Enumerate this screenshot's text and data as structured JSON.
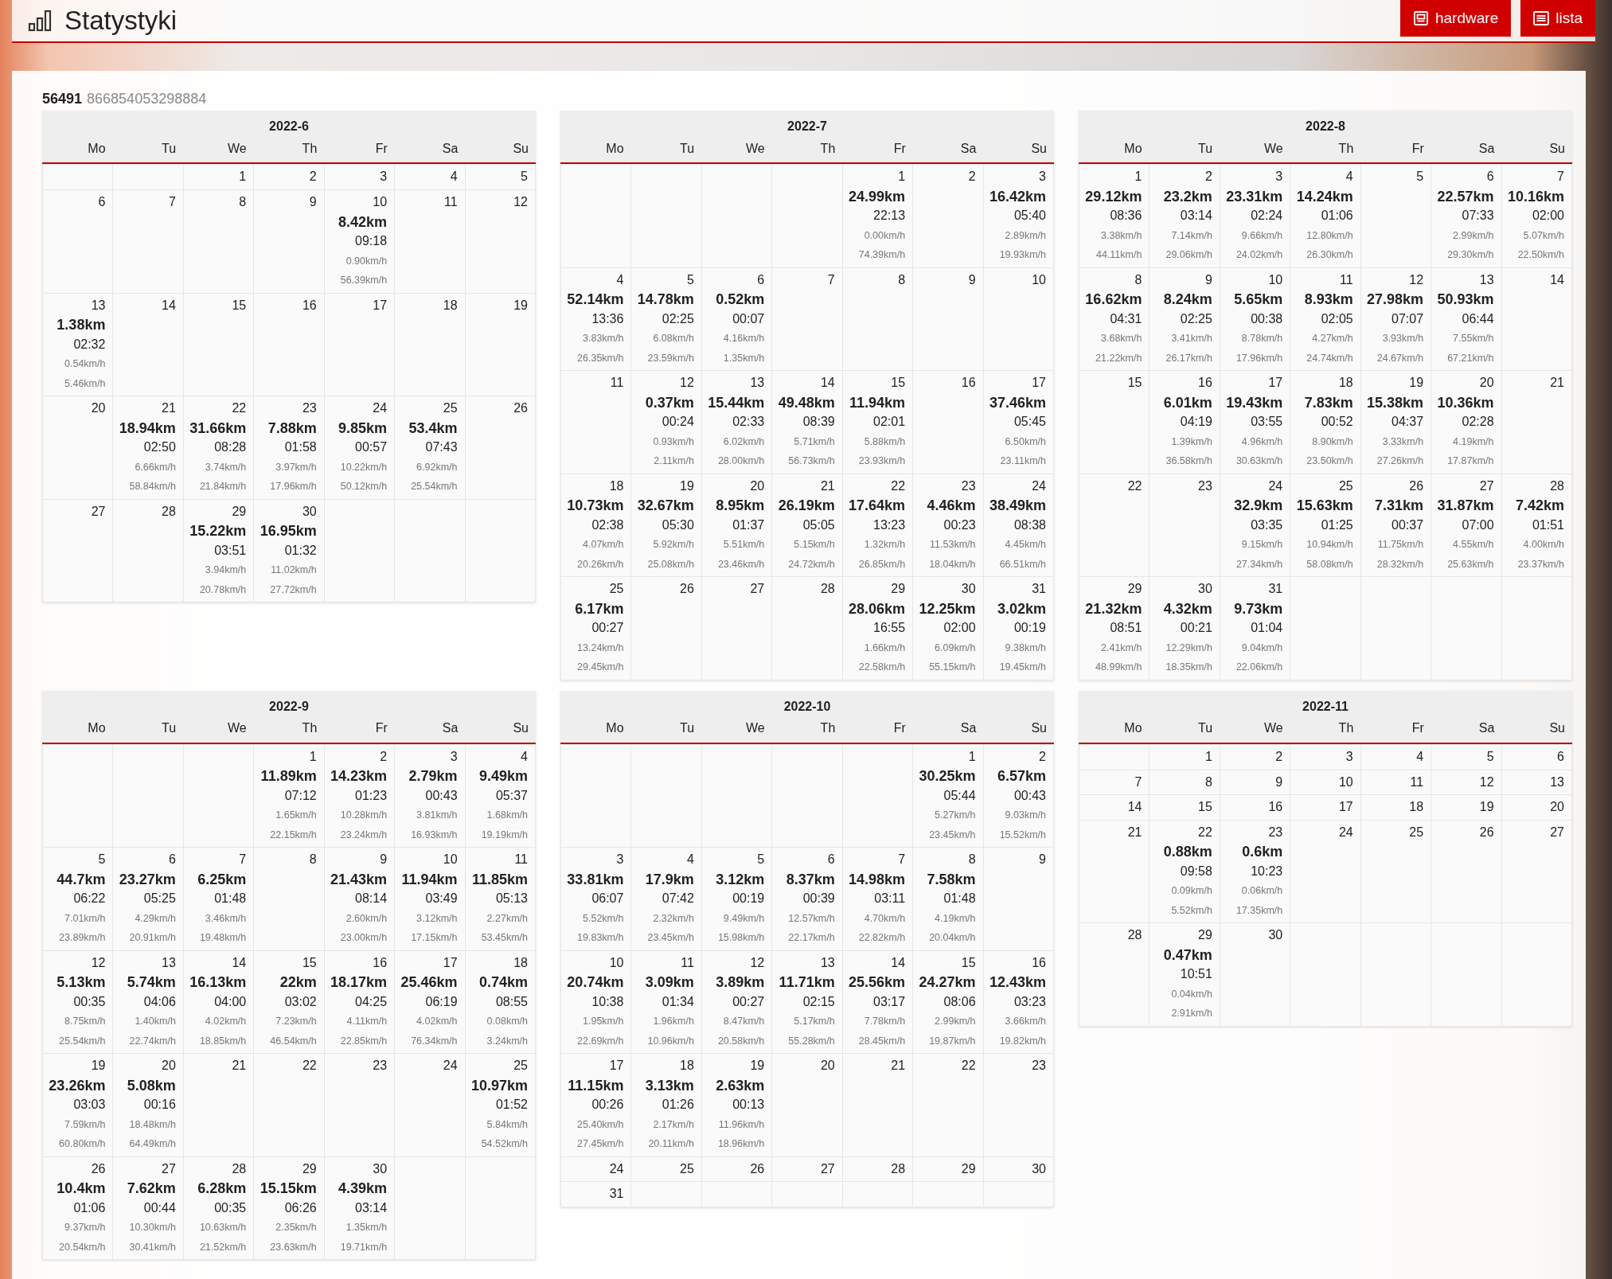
{
  "header": {
    "title": "Statystyki",
    "buttons": [
      {
        "label": "hardware",
        "kind": "hardware"
      },
      {
        "label": "lista",
        "kind": "list"
      }
    ]
  },
  "device": {
    "id": "56491",
    "serial": "866854053298884"
  },
  "months": [
    {
      "title": "2022-6",
      "weekdays": [
        "Mo",
        "Tu",
        "We",
        "Th",
        "Fr",
        "Sa",
        "Su"
      ],
      "weeks": [
        [
          {
            "kind": "blank"
          },
          {
            "kind": "blank"
          },
          {
            "day": "1"
          },
          {
            "day": "2"
          },
          {
            "day": "3"
          },
          {
            "day": "4"
          },
          {
            "day": "5"
          }
        ],
        [
          {
            "day": "6"
          },
          {
            "day": "7"
          },
          {
            "day": "8"
          },
          {
            "day": "9"
          },
          {
            "day": "10",
            "distance": "8.42km",
            "duration": "09:18",
            "speed_1": "0.90km/h",
            "speed_2": "56.39km/h"
          },
          {
            "day": "11"
          },
          {
            "day": "12"
          }
        ],
        [
          {
            "day": "13",
            "distance": "1.38km",
            "duration": "02:32",
            "speed_1": "0.54km/h",
            "speed_2": "5.46km/h"
          },
          {
            "day": "14"
          },
          {
            "day": "15"
          },
          {
            "day": "16"
          },
          {
            "day": "17"
          },
          {
            "day": "18"
          },
          {
            "day": "19"
          }
        ],
        [
          {
            "day": "20"
          },
          {
            "day": "21",
            "distance": "18.94km",
            "duration": "02:50",
            "speed_1": "6.66km/h",
            "speed_2": "58.84km/h"
          },
          {
            "day": "22",
            "distance": "31.66km",
            "duration": "08:28",
            "speed_1": "3.74km/h",
            "speed_2": "21.84km/h"
          },
          {
            "day": "23",
            "distance": "7.88km",
            "duration": "01:58",
            "speed_1": "3.97km/h",
            "speed_2": "17.96km/h"
          },
          {
            "day": "24",
            "distance": "9.85km",
            "duration": "00:57",
            "speed_1": "10.22km/h",
            "speed_2": "50.12km/h"
          },
          {
            "day": "25",
            "distance": "53.4km",
            "duration": "07:43",
            "speed_1": "6.92km/h",
            "speed_2": "25.54km/h"
          },
          {
            "day": "26"
          }
        ],
        [
          {
            "day": "27"
          },
          {
            "day": "28"
          },
          {
            "day": "29",
            "distance": "15.22km",
            "duration": "03:51",
            "speed_1": "3.94km/h",
            "speed_2": "20.78km/h"
          },
          {
            "day": "30",
            "distance": "16.95km",
            "duration": "01:32",
            "speed_1": "11.02km/h",
            "speed_2": "27.72km/h"
          },
          {
            "kind": "blank"
          },
          {
            "kind": "blank"
          },
          {
            "kind": "blank"
          }
        ]
      ]
    },
    {
      "title": "2022-7",
      "weekdays": [
        "Mo",
        "Tu",
        "We",
        "Th",
        "Fr",
        "Sa",
        "Su"
      ],
      "weeks": [
        [
          {
            "kind": "blank"
          },
          {
            "kind": "blank"
          },
          {
            "kind": "blank"
          },
          {
            "kind": "blank"
          },
          {
            "day": "1",
            "distance": "24.99km",
            "duration": "22:13",
            "speed_1": "0.00km/h",
            "speed_2": "74.39km/h"
          },
          {
            "day": "2"
          },
          {
            "day": "3",
            "distance": "16.42km",
            "duration": "05:40",
            "speed_1": "2.89km/h",
            "speed_2": "19.93km/h"
          }
        ],
        [
          {
            "day": "4",
            "distance": "52.14km",
            "duration": "13:36",
            "speed_1": "3.83km/h",
            "speed_2": "26.35km/h"
          },
          {
            "day": "5",
            "distance": "14.78km",
            "duration": "02:25",
            "speed_1": "6.08km/h",
            "speed_2": "23.59km/h"
          },
          {
            "day": "6",
            "distance": "0.52km",
            "duration": "00:07",
            "speed_1": "4.16km/h",
            "speed_2": "1.35km/h"
          },
          {
            "day": "7"
          },
          {
            "day": "8"
          },
          {
            "day": "9"
          },
          {
            "day": "10"
          }
        ],
        [
          {
            "day": "11"
          },
          {
            "day": "12",
            "distance": "0.37km",
            "duration": "00:24",
            "speed_1": "0.93km/h",
            "speed_2": "2.11km/h"
          },
          {
            "day": "13",
            "distance": "15.44km",
            "duration": "02:33",
            "speed_1": "6.02km/h",
            "speed_2": "28.00km/h"
          },
          {
            "day": "14",
            "distance": "49.48km",
            "duration": "08:39",
            "speed_1": "5.71km/h",
            "speed_2": "56.73km/h"
          },
          {
            "day": "15",
            "distance": "11.94km",
            "duration": "02:01",
            "speed_1": "5.88km/h",
            "speed_2": "23.93km/h"
          },
          {
            "day": "16"
          },
          {
            "day": "17",
            "distance": "37.46km",
            "duration": "05:45",
            "speed_1": "6.50km/h",
            "speed_2": "23.11km/h"
          }
        ],
        [
          {
            "day": "18",
            "distance": "10.73km",
            "duration": "02:38",
            "speed_1": "4.07km/h",
            "speed_2": "20.26km/h"
          },
          {
            "day": "19",
            "distance": "32.67km",
            "duration": "05:30",
            "speed_1": "5.92km/h",
            "speed_2": "25.08km/h"
          },
          {
            "day": "20",
            "distance": "8.95km",
            "duration": "01:37",
            "speed_1": "5.51km/h",
            "speed_2": "23.46km/h"
          },
          {
            "day": "21",
            "distance": "26.19km",
            "duration": "05:05",
            "speed_1": "5.15km/h",
            "speed_2": "24.72km/h"
          },
          {
            "day": "22",
            "distance": "17.64km",
            "duration": "13:23",
            "speed_1": "1.32km/h",
            "speed_2": "26.85km/h"
          },
          {
            "day": "23",
            "distance": "4.46km",
            "duration": "00:23",
            "speed_1": "11.53km/h",
            "speed_2": "18.04km/h"
          },
          {
            "day": "24",
            "distance": "38.49km",
            "duration": "08:38",
            "speed_1": "4.45km/h",
            "speed_2": "66.51km/h"
          }
        ],
        [
          {
            "day": "25",
            "distance": "6.17km",
            "duration": "00:27",
            "speed_1": "13.24km/h",
            "speed_2": "29.45km/h"
          },
          {
            "day": "26"
          },
          {
            "day": "27"
          },
          {
            "day": "28"
          },
          {
            "day": "29",
            "distance": "28.06km",
            "duration": "16:55",
            "speed_1": "1.66km/h",
            "speed_2": "22.58km/h"
          },
          {
            "day": "30",
            "distance": "12.25km",
            "duration": "02:00",
            "speed_1": "6.09km/h",
            "speed_2": "55.15km/h"
          },
          {
            "day": "31",
            "distance": "3.02km",
            "duration": "00:19",
            "speed_1": "9.38km/h",
            "speed_2": "19.45km/h"
          }
        ]
      ]
    },
    {
      "title": "2022-8",
      "weekdays": [
        "Mo",
        "Tu",
        "We",
        "Th",
        "Fr",
        "Sa",
        "Su"
      ],
      "weeks": [
        [
          {
            "day": "1",
            "distance": "29.12km",
            "duration": "08:36",
            "speed_1": "3.38km/h",
            "speed_2": "44.11km/h"
          },
          {
            "day": "2",
            "distance": "23.2km",
            "duration": "03:14",
            "speed_1": "7.14km/h",
            "speed_2": "29.06km/h"
          },
          {
            "day": "3",
            "distance": "23.31km",
            "duration": "02:24",
            "speed_1": "9.66km/h",
            "speed_2": "24.02km/h"
          },
          {
            "day": "4",
            "distance": "14.24km",
            "duration": "01:06",
            "speed_1": "12.80km/h",
            "speed_2": "26.30km/h"
          },
          {
            "day": "5"
          },
          {
            "day": "6",
            "distance": "22.57km",
            "duration": "07:33",
            "speed_1": "2.99km/h",
            "speed_2": "29.30km/h"
          },
          {
            "day": "7",
            "distance": "10.16km",
            "duration": "02:00",
            "speed_1": "5.07km/h",
            "speed_2": "22.50km/h"
          }
        ],
        [
          {
            "day": "8",
            "distance": "16.62km",
            "duration": "04:31",
            "speed_1": "3.68km/h",
            "speed_2": "21.22km/h"
          },
          {
            "day": "9",
            "distance": "8.24km",
            "duration": "02:25",
            "speed_1": "3.41km/h",
            "speed_2": "26.17km/h"
          },
          {
            "day": "10",
            "distance": "5.65km",
            "duration": "00:38",
            "speed_1": "8.78km/h",
            "speed_2": "17.96km/h"
          },
          {
            "day": "11",
            "distance": "8.93km",
            "duration": "02:05",
            "speed_1": "4.27km/h",
            "speed_2": "24.74km/h"
          },
          {
            "day": "12",
            "distance": "27.98km",
            "duration": "07:07",
            "speed_1": "3.93km/h",
            "speed_2": "24.67km/h"
          },
          {
            "day": "13",
            "distance": "50.93km",
            "duration": "06:44",
            "speed_1": "7.55km/h",
            "speed_2": "67.21km/h"
          },
          {
            "day": "14"
          }
        ],
        [
          {
            "day": "15"
          },
          {
            "day": "16",
            "distance": "6.01km",
            "duration": "04:19",
            "speed_1": "1.39km/h",
            "speed_2": "36.58km/h"
          },
          {
            "day": "17",
            "distance": "19.43km",
            "duration": "03:55",
            "speed_1": "4.96km/h",
            "speed_2": "30.63km/h"
          },
          {
            "day": "18",
            "distance": "7.83km",
            "duration": "00:52",
            "speed_1": "8.90km/h",
            "speed_2": "23.50km/h"
          },
          {
            "day": "19",
            "distance": "15.38km",
            "duration": "04:37",
            "speed_1": "3.33km/h",
            "speed_2": "27.26km/h"
          },
          {
            "day": "20",
            "distance": "10.36km",
            "duration": "02:28",
            "speed_1": "4.19km/h",
            "speed_2": "17.87km/h"
          },
          {
            "day": "21"
          }
        ],
        [
          {
            "day": "22"
          },
          {
            "day": "23"
          },
          {
            "day": "24",
            "distance": "32.9km",
            "duration": "03:35",
            "speed_1": "9.15km/h",
            "speed_2": "27.34km/h"
          },
          {
            "day": "25",
            "distance": "15.63km",
            "duration": "01:25",
            "speed_1": "10.94km/h",
            "speed_2": "58.08km/h"
          },
          {
            "day": "26",
            "distance": "7.31km",
            "duration": "00:37",
            "speed_1": "11.75km/h",
            "speed_2": "28.32km/h"
          },
          {
            "day": "27",
            "distance": "31.87km",
            "duration": "07:00",
            "speed_1": "4.55km/h",
            "speed_2": "25.63km/h"
          },
          {
            "day": "28",
            "distance": "7.42km",
            "duration": "01:51",
            "speed_1": "4.00km/h",
            "speed_2": "23.37km/h"
          }
        ],
        [
          {
            "day": "29",
            "distance": "21.32km",
            "duration": "08:51",
            "speed_1": "2.41km/h",
            "speed_2": "48.99km/h"
          },
          {
            "day": "30",
            "distance": "4.32km",
            "duration": "00:21",
            "speed_1": "12.29km/h",
            "speed_2": "18.35km/h"
          },
          {
            "day": "31",
            "distance": "9.73km",
            "duration": "01:04",
            "speed_1": "9.04km/h",
            "speed_2": "22.06km/h"
          },
          {
            "kind": "blank"
          },
          {
            "kind": "blank"
          },
          {
            "kind": "blank"
          },
          {
            "kind": "blank"
          }
        ]
      ]
    },
    {
      "title": "2022-9",
      "weekdays": [
        "Mo",
        "Tu",
        "We",
        "Th",
        "Fr",
        "Sa",
        "Su"
      ],
      "weeks": [
        [
          {
            "kind": "blank"
          },
          {
            "kind": "blank"
          },
          {
            "kind": "blank"
          },
          {
            "day": "1",
            "distance": "11.89km",
            "duration": "07:12",
            "speed_1": "1.65km/h",
            "speed_2": "22.15km/h"
          },
          {
            "day": "2",
            "distance": "14.23km",
            "duration": "01:23",
            "speed_1": "10.28km/h",
            "speed_2": "23.24km/h"
          },
          {
            "day": "3",
            "distance": "2.79km",
            "duration": "00:43",
            "speed_1": "3.81km/h",
            "speed_2": "16.93km/h"
          },
          {
            "day": "4",
            "distance": "9.49km",
            "duration": "05:37",
            "speed_1": "1.68km/h",
            "speed_2": "19.19km/h"
          }
        ],
        [
          {
            "day": "5",
            "distance": "44.7km",
            "duration": "06:22",
            "speed_1": "7.01km/h",
            "speed_2": "23.89km/h"
          },
          {
            "day": "6",
            "distance": "23.27km",
            "duration": "05:25",
            "speed_1": "4.29km/h",
            "speed_2": "20.91km/h"
          },
          {
            "day": "7",
            "distance": "6.25km",
            "duration": "01:48",
            "speed_1": "3.46km/h",
            "speed_2": "19.48km/h"
          },
          {
            "day": "8"
          },
          {
            "day": "9",
            "distance": "21.43km",
            "duration": "08:14",
            "speed_1": "2.60km/h",
            "speed_2": "23.00km/h"
          },
          {
            "day": "10",
            "distance": "11.94km",
            "duration": "03:49",
            "speed_1": "3.12km/h",
            "speed_2": "17.15km/h"
          },
          {
            "day": "11",
            "distance": "11.85km",
            "duration": "05:13",
            "speed_1": "2.27km/h",
            "speed_2": "53.45km/h"
          }
        ],
        [
          {
            "day": "12",
            "distance": "5.13km",
            "duration": "00:35",
            "speed_1": "8.75km/h",
            "speed_2": "25.54km/h"
          },
          {
            "day": "13",
            "distance": "5.74km",
            "duration": "04:06",
            "speed_1": "1.40km/h",
            "speed_2": "22.74km/h"
          },
          {
            "day": "14",
            "distance": "16.13km",
            "duration": "04:00",
            "speed_1": "4.02km/h",
            "speed_2": "18.85km/h"
          },
          {
            "day": "15",
            "distance": "22km",
            "duration": "03:02",
            "speed_1": "7.23km/h",
            "speed_2": "46.54km/h"
          },
          {
            "day": "16",
            "distance": "18.17km",
            "duration": "04:25",
            "speed_1": "4.11km/h",
            "speed_2": "22.85km/h"
          },
          {
            "day": "17",
            "distance": "25.46km",
            "duration": "06:19",
            "speed_1": "4.02km/h",
            "speed_2": "76.34km/h"
          },
          {
            "day": "18",
            "distance": "0.74km",
            "duration": "08:55",
            "speed_1": "0.08km/h",
            "speed_2": "3.24km/h"
          }
        ],
        [
          {
            "day": "19",
            "distance": "23.26km",
            "duration": "03:03",
            "speed_1": "7.59km/h",
            "speed_2": "60.80km/h"
          },
          {
            "day": "20",
            "distance": "5.08km",
            "duration": "00:16",
            "speed_1": "18.48km/h",
            "speed_2": "64.49km/h"
          },
          {
            "day": "21"
          },
          {
            "day": "22"
          },
          {
            "day": "23"
          },
          {
            "day": "24"
          },
          {
            "day": "25",
            "distance": "10.97km",
            "duration": "01:52",
            "speed_1": "5.84km/h",
            "speed_2": "54.52km/h"
          }
        ],
        [
          {
            "day": "26",
            "distance": "10.4km",
            "duration": "01:06",
            "speed_1": "9.37km/h",
            "speed_2": "20.54km/h"
          },
          {
            "day": "27",
            "distance": "7.62km",
            "duration": "00:44",
            "speed_1": "10.30km/h",
            "speed_2": "30.41km/h"
          },
          {
            "day": "28",
            "distance": "6.28km",
            "duration": "00:35",
            "speed_1": "10.63km/h",
            "speed_2": "21.52km/h"
          },
          {
            "day": "29",
            "distance": "15.15km",
            "duration": "06:26",
            "speed_1": "2.35km/h",
            "speed_2": "23.63km/h"
          },
          {
            "day": "30",
            "distance": "4.39km",
            "duration": "03:14",
            "speed_1": "1.35km/h",
            "speed_2": "19.71km/h"
          },
          {
            "kind": "blank"
          },
          {
            "kind": "blank"
          }
        ]
      ]
    },
    {
      "title": "2022-10",
      "weekdays": [
        "Mo",
        "Tu",
        "We",
        "Th",
        "Fr",
        "Sa",
        "Su"
      ],
      "weeks": [
        [
          {
            "kind": "blank"
          },
          {
            "kind": "blank"
          },
          {
            "kind": "blank"
          },
          {
            "kind": "blank"
          },
          {
            "kind": "blank"
          },
          {
            "day": "1",
            "distance": "30.25km",
            "duration": "05:44",
            "speed_1": "5.27km/h",
            "speed_2": "23.45km/h"
          },
          {
            "day": "2",
            "distance": "6.57km",
            "duration": "00:43",
            "speed_1": "9.03km/h",
            "speed_2": "15.52km/h"
          }
        ],
        [
          {
            "day": "3",
            "distance": "33.81km",
            "duration": "06:07",
            "speed_1": "5.52km/h",
            "speed_2": "19.83km/h"
          },
          {
            "day": "4",
            "distance": "17.9km",
            "duration": "07:42",
            "speed_1": "2.32km/h",
            "speed_2": "23.45km/h"
          },
          {
            "day": "5",
            "distance": "3.12km",
            "duration": "00:19",
            "speed_1": "9.49km/h",
            "speed_2": "15.98km/h"
          },
          {
            "day": "6",
            "distance": "8.37km",
            "duration": "00:39",
            "speed_1": "12.57km/h",
            "speed_2": "22.17km/h"
          },
          {
            "day": "7",
            "distance": "14.98km",
            "duration": "03:11",
            "speed_1": "4.70km/h",
            "speed_2": "22.82km/h"
          },
          {
            "day": "8",
            "distance": "7.58km",
            "duration": "01:48",
            "speed_1": "4.19km/h",
            "speed_2": "20.04km/h"
          },
          {
            "day": "9"
          }
        ],
        [
          {
            "day": "10",
            "distance": "20.74km",
            "duration": "10:38",
            "speed_1": "1.95km/h",
            "speed_2": "22.69km/h"
          },
          {
            "day": "11",
            "distance": "3.09km",
            "duration": "01:34",
            "speed_1": "1.96km/h",
            "speed_2": "10.96km/h"
          },
          {
            "day": "12",
            "distance": "3.89km",
            "duration": "00:27",
            "speed_1": "8.47km/h",
            "speed_2": "20.58km/h"
          },
          {
            "day": "13",
            "distance": "11.71km",
            "duration": "02:15",
            "speed_1": "5.17km/h",
            "speed_2": "55.28km/h"
          },
          {
            "day": "14",
            "distance": "25.56km",
            "duration": "03:17",
            "speed_1": "7.78km/h",
            "speed_2": "28.45km/h"
          },
          {
            "day": "15",
            "distance": "24.27km",
            "duration": "08:06",
            "speed_1": "2.99km/h",
            "speed_2": "19.87km/h"
          },
          {
            "day": "16",
            "distance": "12.43km",
            "duration": "03:23",
            "speed_1": "3.66km/h",
            "speed_2": "19.82km/h"
          }
        ],
        [
          {
            "day": "17",
            "distance": "11.15km",
            "duration": "00:26",
            "speed_1": "25.40km/h",
            "speed_2": "27.45km/h"
          },
          {
            "day": "18",
            "distance": "3.13km",
            "duration": "01:26",
            "speed_1": "2.17km/h",
            "speed_2": "20.11km/h"
          },
          {
            "day": "19",
            "distance": "2.63km",
            "duration": "00:13",
            "speed_1": "11.96km/h",
            "speed_2": "18.96km/h"
          },
          {
            "day": "20"
          },
          {
            "day": "21"
          },
          {
            "day": "22"
          },
          {
            "day": "23"
          }
        ],
        [
          {
            "day": "24"
          },
          {
            "day": "25"
          },
          {
            "day": "26"
          },
          {
            "day": "27"
          },
          {
            "day": "28"
          },
          {
            "day": "29"
          },
          {
            "day": "30"
          }
        ],
        [
          {
            "day": "31"
          },
          {
            "kind": "blank"
          },
          {
            "kind": "blank"
          },
          {
            "kind": "blank"
          },
          {
            "kind": "blank"
          },
          {
            "kind": "blank"
          },
          {
            "kind": "blank"
          }
        ]
      ]
    },
    {
      "title": "2022-11",
      "weekdays": [
        "Mo",
        "Tu",
        "We",
        "Th",
        "Fr",
        "Sa",
        "Su"
      ],
      "weeks": [
        [
          {
            "kind": "blank"
          },
          {
            "day": "1"
          },
          {
            "day": "2"
          },
          {
            "day": "3"
          },
          {
            "day": "4"
          },
          {
            "day": "5"
          },
          {
            "day": "6"
          }
        ],
        [
          {
            "day": "7"
          },
          {
            "day": "8"
          },
          {
            "day": "9"
          },
          {
            "day": "10"
          },
          {
            "day": "11"
          },
          {
            "day": "12"
          },
          {
            "day": "13"
          }
        ],
        [
          {
            "day": "14"
          },
          {
            "day": "15"
          },
          {
            "day": "16"
          },
          {
            "day": "17"
          },
          {
            "day": "18"
          },
          {
            "day": "19"
          },
          {
            "day": "20"
          }
        ],
        [
          {
            "day": "21"
          },
          {
            "day": "22",
            "distance": "0.88km",
            "duration": "09:58",
            "speed_1": "0.09km/h",
            "speed_2": "5.52km/h"
          },
          {
            "day": "23",
            "distance": "0.6km",
            "duration": "10:23",
            "speed_1": "0.06km/h",
            "speed_2": "17.35km/h"
          },
          {
            "day": "24"
          },
          {
            "day": "25"
          },
          {
            "day": "26"
          },
          {
            "day": "27"
          }
        ],
        [
          {
            "day": "28"
          },
          {
            "day": "29",
            "distance": "0.47km",
            "duration": "10:51",
            "speed_1": "0.04km/h",
            "speed_2": "2.91km/h"
          },
          {
            "day": "30"
          },
          {
            "kind": "blank"
          },
          {
            "kind": "blank"
          },
          {
            "kind": "blank"
          },
          {
            "kind": "blank"
          }
        ]
      ]
    }
  ]
}
